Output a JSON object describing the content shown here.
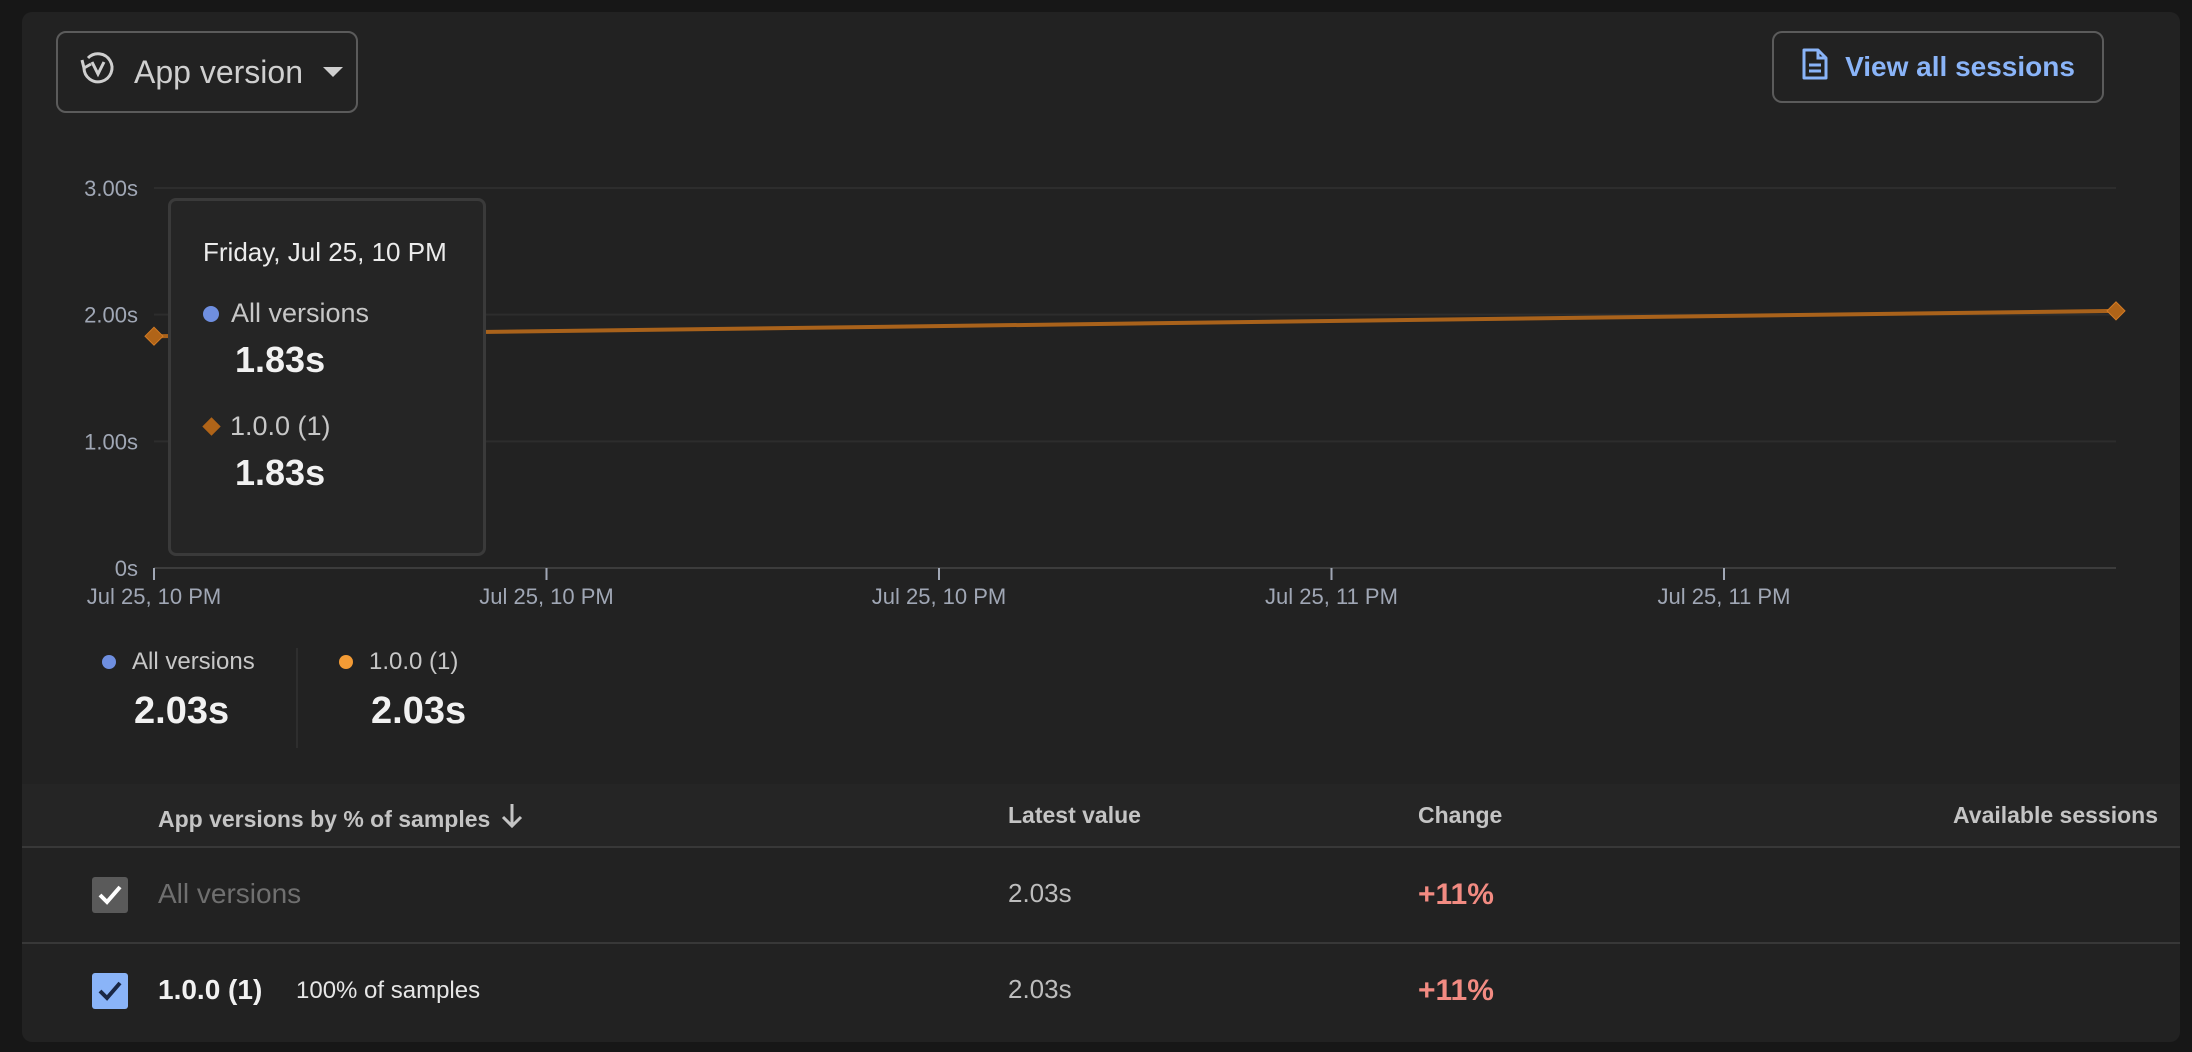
{
  "header": {
    "version_button_label": "App version",
    "sessions_button_label": "View all sessions"
  },
  "colors": {
    "all_versions": "#6f8fe0",
    "version_1_0_0": "#e0841f",
    "accent_link": "#8ab4f8",
    "positive_change": "#f28b82"
  },
  "chart_data": {
    "type": "line",
    "y_ticks": [
      "3.00s",
      "2.00s",
      "1.00s",
      "0s"
    ],
    "ylim": [
      0,
      3
    ],
    "x_tick_labels": [
      "Jul 25, 10 PM",
      "Jul 25, 10 PM",
      "Jul 25, 10 PM",
      "Jul 25, 11 PM",
      "Jul 25, 11 PM"
    ],
    "grid": true,
    "series": [
      {
        "name": "1.0.0 (1)",
        "marker": "diamond",
        "points": [
          {
            "x": 0,
            "y": 1.83
          },
          {
            "x": 1,
            "y": 2.03
          }
        ]
      }
    ]
  },
  "tooltip": {
    "date": "Friday, Jul 25, 10 PM",
    "rows": [
      {
        "label": "All versions",
        "value": "1.83s"
      },
      {
        "label": "1.0.0 (1)",
        "value": "1.83s"
      }
    ]
  },
  "legend": [
    {
      "label": "All versions",
      "value": "2.03s"
    },
    {
      "label": "1.0.0 (1)",
      "value": "2.03s"
    }
  ],
  "table": {
    "columns": [
      "App versions by % of samples",
      "Latest value",
      "Change",
      "Available sessions"
    ],
    "rows": [
      {
        "version": "All versions",
        "samples": "",
        "latest": "2.03s",
        "change": "+11%",
        "checked": true
      },
      {
        "version": "1.0.0 (1)",
        "samples": "100% of samples",
        "latest": "2.03s",
        "change": "+11%",
        "checked": true
      }
    ]
  }
}
